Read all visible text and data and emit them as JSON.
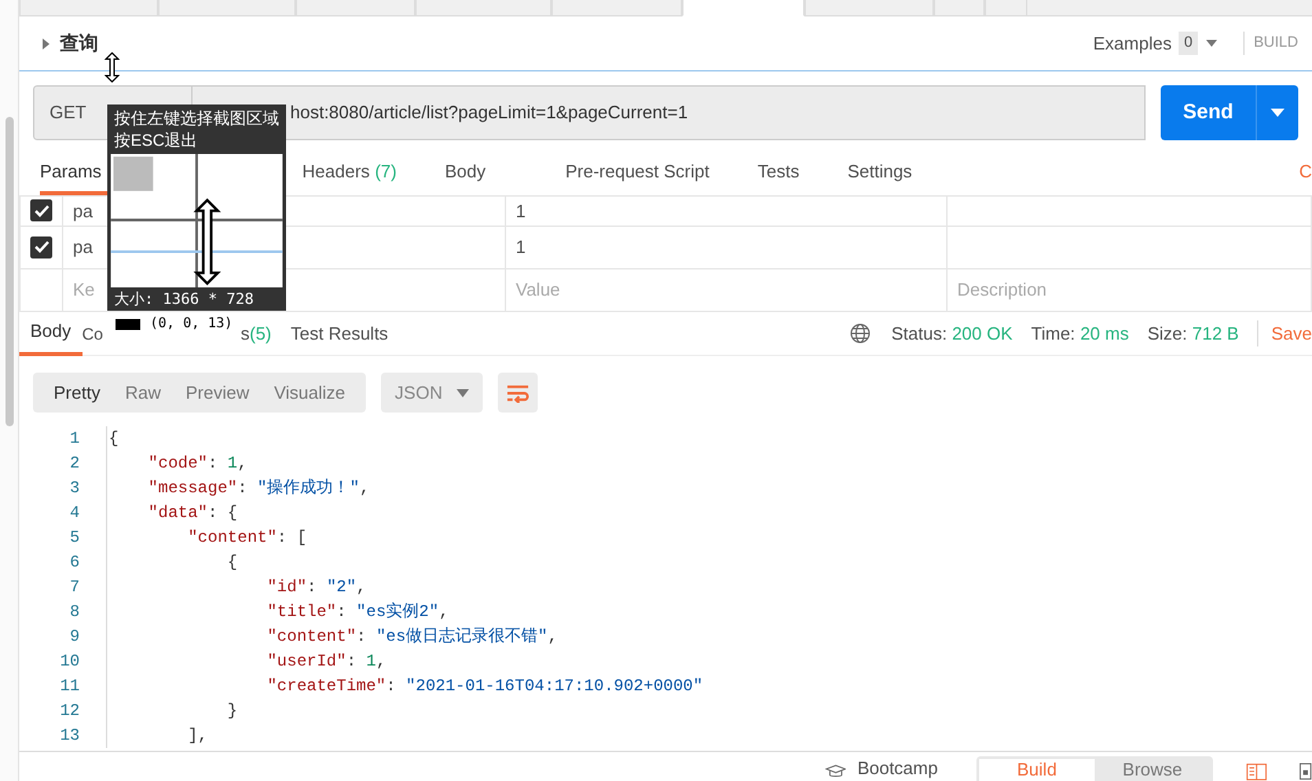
{
  "top_tabs": [
    {
      "selected": false
    },
    {
      "selected": false
    },
    {
      "selected": false
    },
    {
      "selected": false
    },
    {
      "selected": false
    },
    {
      "selected": true
    },
    {
      "selected": false
    },
    {
      "selected": false
    },
    {
      "selected": false
    }
  ],
  "request": {
    "title": "查询",
    "examples_label": "Examples",
    "examples_count": "0",
    "build": "BUILD",
    "method": "GET",
    "url": "host:8080/article/list?pageLimit=1&pageCurrent=1",
    "send": "Send"
  },
  "request_tabs": [
    {
      "label": "Params",
      "selected": true
    },
    {
      "label": "Headers",
      "count": "(7)",
      "selected": false
    },
    {
      "label": "Body",
      "selected": false
    },
    {
      "label": "Pre-request Script",
      "selected": false
    },
    {
      "label": "Tests",
      "selected": false
    },
    {
      "label": "Settings",
      "selected": false
    }
  ],
  "cookies_link": "C",
  "params": {
    "rows": [
      {
        "checked": true,
        "key": "pa",
        "value": "1"
      },
      {
        "checked": true,
        "key": "pa",
        "value": "1"
      }
    ],
    "new_row": {
      "key_placeholder": "Ke",
      "value_placeholder": "Value",
      "description_placeholder": "Description"
    }
  },
  "response_tabs": [
    {
      "label": "Body",
      "selected": true
    },
    {
      "label": "Co",
      "selected": false
    },
    {
      "label": "s",
      "count": "(5)",
      "selected": false
    },
    {
      "label": "Test Results",
      "selected": false
    }
  ],
  "response_meta": {
    "status_label": "Status:",
    "status": "200 OK",
    "time_label": "Time:",
    "time": "20 ms",
    "size_label": "Size:",
    "size": "712 B",
    "save": "Save"
  },
  "view_modes": [
    {
      "label": "Pretty",
      "selected": true
    },
    {
      "label": "Raw",
      "selected": false
    },
    {
      "label": "Preview",
      "selected": false
    },
    {
      "label": "Visualize",
      "selected": false
    }
  ],
  "format": "JSON",
  "code_lines": [
    {
      "number": "1",
      "tokens": [
        {
          "kind": "punct",
          "text": "{"
        }
      ]
    },
    {
      "number": "2",
      "tokens": [
        {
          "kind": "key",
          "text": "    \"code\""
        },
        {
          "kind": "punct",
          "text": ": "
        },
        {
          "kind": "number",
          "text": "1"
        },
        {
          "kind": "punct",
          "text": ","
        }
      ]
    },
    {
      "number": "3",
      "tokens": [
        {
          "kind": "key",
          "text": "    \"message\""
        },
        {
          "kind": "punct",
          "text": ": "
        },
        {
          "kind": "string",
          "text": "\"操作成功！\""
        },
        {
          "kind": "punct",
          "text": ","
        }
      ]
    },
    {
      "number": "4",
      "tokens": [
        {
          "kind": "key",
          "text": "    \"data\""
        },
        {
          "kind": "punct",
          "text": ": {"
        }
      ]
    },
    {
      "number": "5",
      "tokens": [
        {
          "kind": "key",
          "text": "        \"content\""
        },
        {
          "kind": "punct",
          "text": ": ["
        }
      ]
    },
    {
      "number": "6",
      "tokens": [
        {
          "kind": "punct",
          "text": "            {"
        }
      ]
    },
    {
      "number": "7",
      "tokens": [
        {
          "kind": "key",
          "text": "                \"id\""
        },
        {
          "kind": "punct",
          "text": ": "
        },
        {
          "kind": "string",
          "text": "\"2\""
        },
        {
          "kind": "punct",
          "text": ","
        }
      ]
    },
    {
      "number": "8",
      "tokens": [
        {
          "kind": "key",
          "text": "                \"title\""
        },
        {
          "kind": "punct",
          "text": ": "
        },
        {
          "kind": "string",
          "text": "\"es实例2\""
        },
        {
          "kind": "punct",
          "text": ","
        }
      ]
    },
    {
      "number": "9",
      "tokens": [
        {
          "kind": "key",
          "text": "                \"content\""
        },
        {
          "kind": "punct",
          "text": ": "
        },
        {
          "kind": "string",
          "text": "\"es做日志记录很不错\""
        },
        {
          "kind": "punct",
          "text": ","
        }
      ]
    },
    {
      "number": "10",
      "tokens": [
        {
          "kind": "key",
          "text": "                \"userId\""
        },
        {
          "kind": "punct",
          "text": ": "
        },
        {
          "kind": "number",
          "text": "1"
        },
        {
          "kind": "punct",
          "text": ","
        }
      ]
    },
    {
      "number": "11",
      "tokens": [
        {
          "kind": "key",
          "text": "                \"createTime\""
        },
        {
          "kind": "punct",
          "text": ": "
        },
        {
          "kind": "string",
          "text": "\"2021-01-16T04:17:10.902+0000\""
        }
      ]
    },
    {
      "number": "12",
      "tokens": [
        {
          "kind": "punct",
          "text": "            }"
        }
      ]
    },
    {
      "number": "13",
      "tokens": [
        {
          "kind": "punct",
          "text": "        ],"
        }
      ]
    }
  ],
  "footer": {
    "bootcamp": "Bootcamp",
    "modes": [
      {
        "label": "Build",
        "selected": true
      },
      {
        "label": "Browse",
        "selected": false
      }
    ]
  },
  "capture_overlay": {
    "hint_lines": [
      "按住左键选择截图区域",
      "按ESC退出"
    ],
    "size": "大小: 1366 * 728",
    "pixel_color": "(0, 0, 13)"
  }
}
